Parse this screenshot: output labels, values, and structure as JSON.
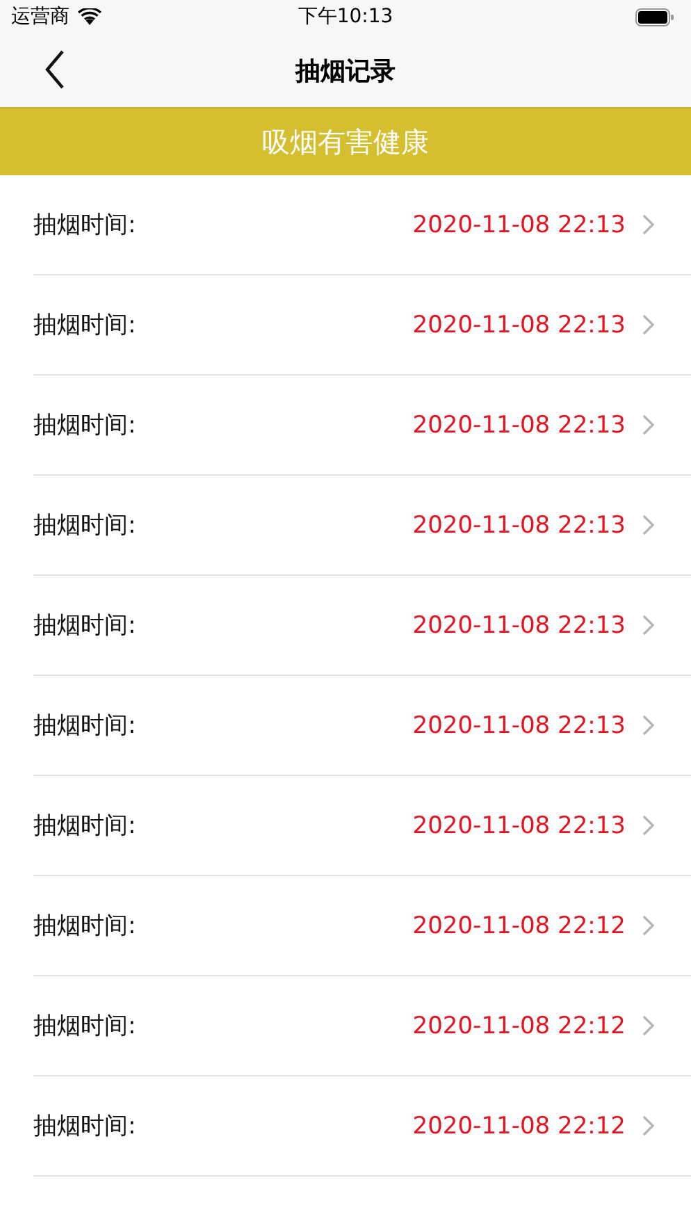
{
  "status_bar": {
    "carrier": "运营商",
    "time": "下午10:13"
  },
  "nav": {
    "title": "抽烟记录"
  },
  "banner": {
    "text": "吸烟有害健康"
  },
  "records": [
    {
      "label": "抽烟时间:",
      "time": "2020-11-08 22:13"
    },
    {
      "label": "抽烟时间:",
      "time": "2020-11-08 22:13"
    },
    {
      "label": "抽烟时间:",
      "time": "2020-11-08 22:13"
    },
    {
      "label": "抽烟时间:",
      "time": "2020-11-08 22:13"
    },
    {
      "label": "抽烟时间:",
      "time": "2020-11-08 22:13"
    },
    {
      "label": "抽烟时间:",
      "time": "2020-11-08 22:13"
    },
    {
      "label": "抽烟时间:",
      "time": "2020-11-08 22:13"
    },
    {
      "label": "抽烟时间:",
      "time": "2020-11-08 22:12"
    },
    {
      "label": "抽烟时间:",
      "time": "2020-11-08 22:12"
    },
    {
      "label": "抽烟时间:",
      "time": "2020-11-08 22:12"
    }
  ]
}
